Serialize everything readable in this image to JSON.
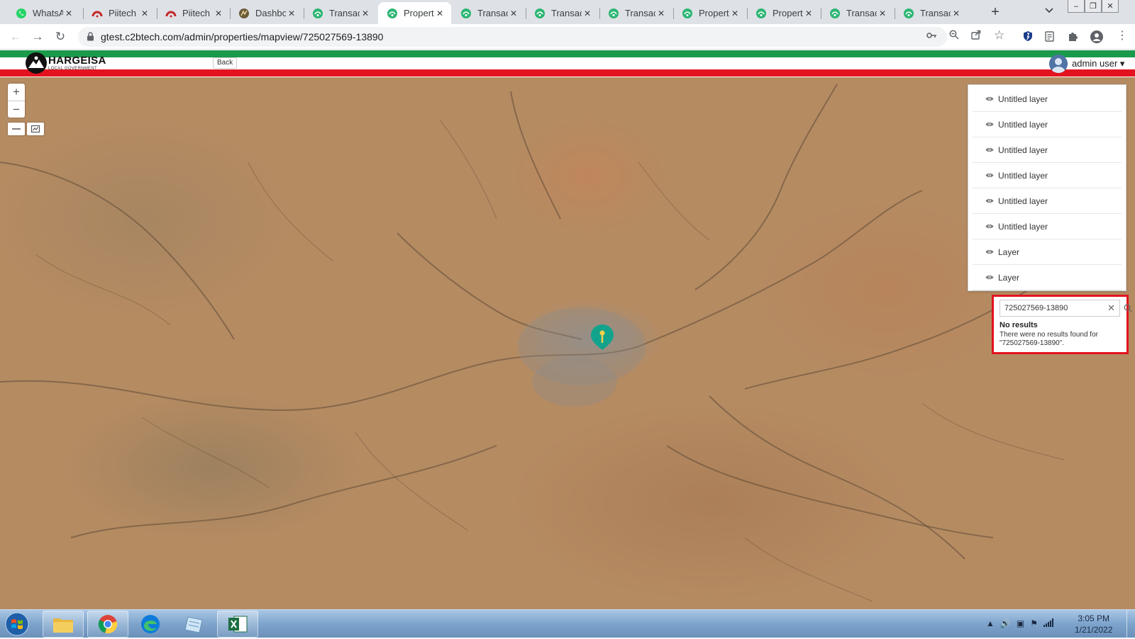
{
  "browser": {
    "tabs": [
      {
        "title": "WhatsA",
        "icon": "whatsapp-icon",
        "active": false
      },
      {
        "title": "Piitech",
        "icon": "piitech-icon",
        "active": false
      },
      {
        "title": "Piitech",
        "icon": "piitech-icon",
        "active": false
      },
      {
        "title": "Dashbo",
        "icon": "dashboard-icon",
        "active": false
      },
      {
        "title": "Transac",
        "icon": "app-logo-icon",
        "active": false
      },
      {
        "title": "Propert",
        "icon": "app-logo-icon",
        "active": true
      },
      {
        "title": "Transac",
        "icon": "app-logo-icon",
        "active": false
      },
      {
        "title": "Transac",
        "icon": "app-logo-icon",
        "active": false
      },
      {
        "title": "Transac",
        "icon": "app-logo-icon",
        "active": false
      },
      {
        "title": "Propert",
        "icon": "app-logo-icon",
        "active": false
      },
      {
        "title": "Propert",
        "icon": "app-logo-icon",
        "active": false
      },
      {
        "title": "Transac",
        "icon": "app-logo-icon",
        "active": false
      },
      {
        "title": "Transac",
        "icon": "app-logo-icon",
        "active": false
      }
    ],
    "close_glyph": "✕",
    "new_tab_glyph": "+",
    "url": "gtest.c2btech.com/admin/properties/mapview/725027569-13890"
  },
  "header": {
    "logo_title": "HARGEISA",
    "logo_subtitle": "LOCAL GOVERNMENT",
    "back_label": "Back",
    "user_name": "admin user ▾"
  },
  "map": {
    "zoom_in": "+",
    "zoom_out": "−",
    "layers": [
      "Untitled layer",
      "Untitled layer",
      "Untitled layer",
      "Untitled layer",
      "Untitled layer",
      "Untitled layer",
      "Layer",
      "Layer"
    ],
    "search": {
      "value": "725027569-13890",
      "clear_glyph": "✕",
      "results_heading": "No results",
      "results_message": "There were no results found for \"725027569-13890\"."
    }
  },
  "taskbar": {
    "apps": [
      "file-explorer",
      "chrome",
      "edge",
      "notepad",
      "excel"
    ],
    "time": "3:05 PM",
    "date": "1/21/2022"
  },
  "colors": {
    "header_green": "#1a9a4a",
    "header_red": "#e3131f",
    "marker": "#13a38c",
    "highlight_border": "#e3131f"
  }
}
